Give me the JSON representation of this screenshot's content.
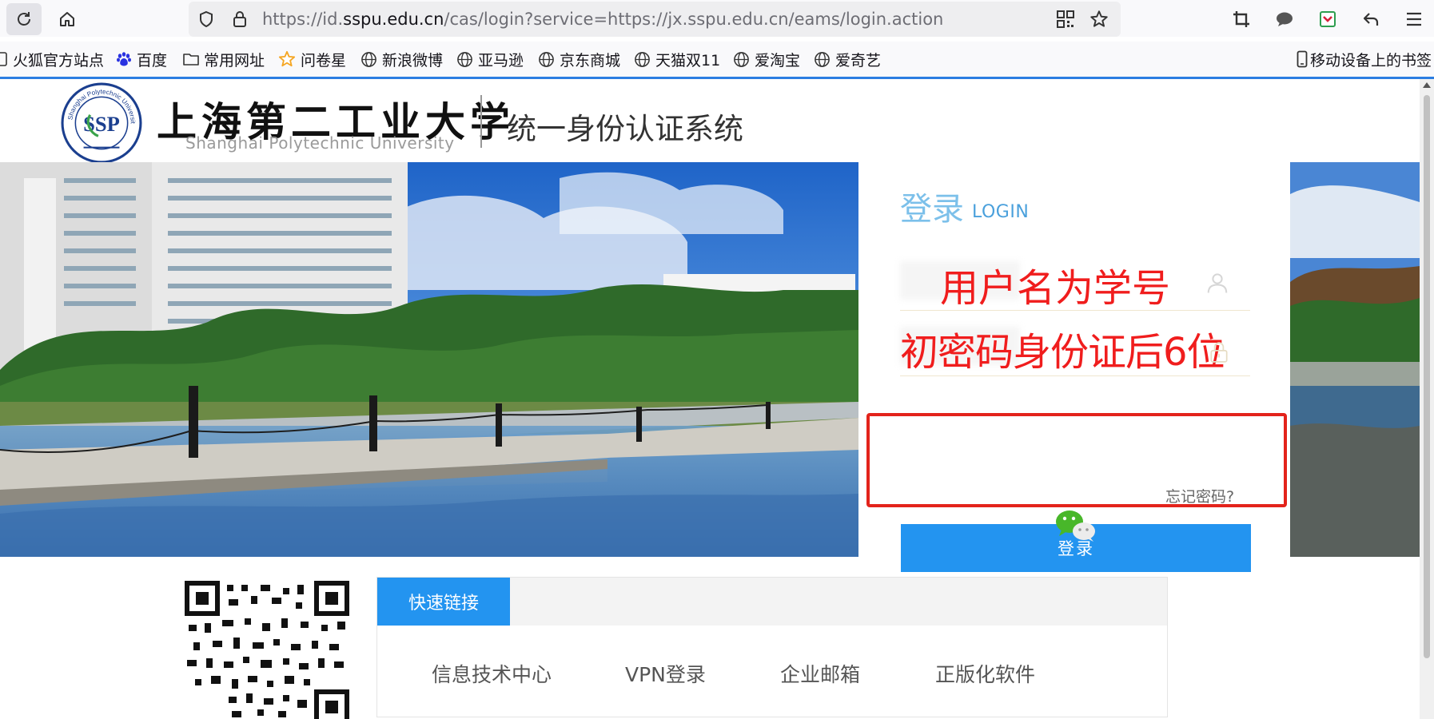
{
  "browser": {
    "url_prefix": "https://id.",
    "url_domain": "sspu.edu.cn",
    "url_rest": "/cas/login?service=https://jx.sspu.edu.cn/eams/login.action",
    "toolbar_icons": [
      "reload-icon",
      "home-icon",
      "shield-icon",
      "lock-icon",
      "qr-code-icon",
      "star-icon",
      "screenshot-icon",
      "chat-icon",
      "pocket-icon",
      "back-arrow-icon",
      "menu-icon"
    ],
    "bookmarks": [
      {
        "label": "火狐官方站点",
        "icon": "page-icon"
      },
      {
        "label": "百度",
        "icon": "baidu-paw-icon"
      },
      {
        "label": "常用网址",
        "icon": "folder-icon"
      },
      {
        "label": "问卷星",
        "icon": "star-logo-icon"
      },
      {
        "label": "新浪微博",
        "icon": "globe-icon"
      },
      {
        "label": "亚马逊",
        "icon": "globe-icon"
      },
      {
        "label": "京东商城",
        "icon": "globe-icon"
      },
      {
        "label": "天猫双11",
        "icon": "globe-icon"
      },
      {
        "label": "爱淘宝",
        "icon": "globe-icon"
      },
      {
        "label": "爱奇艺",
        "icon": "globe-icon"
      }
    ],
    "mobile_bookmarks": "移动设备上的书签",
    "accent_color": "#2b7de1"
  },
  "header": {
    "logo_cn": "上海第二工业大学",
    "logo_en": "Shanghai Polytechnic University",
    "seal_text": "Shanghai Polytechnic University",
    "seal_monogram": "SSP",
    "system_title": "统一身份认证系统"
  },
  "login": {
    "title": "登录",
    "title_en": "LOGIN",
    "username_hint": "用户名为学号",
    "password_hint": "初密码身份证后6位",
    "forgot_password": "忘记密码?",
    "submit_label": "登录",
    "button_color": "#2394f0",
    "annotation_color": "#e3231b",
    "hint_color": "#f01d1d"
  },
  "quick_links": {
    "tab_label": "快速链接",
    "links": [
      "信息技术中心",
      "VPN登录",
      "企业邮箱",
      "正版化软件"
    ]
  }
}
